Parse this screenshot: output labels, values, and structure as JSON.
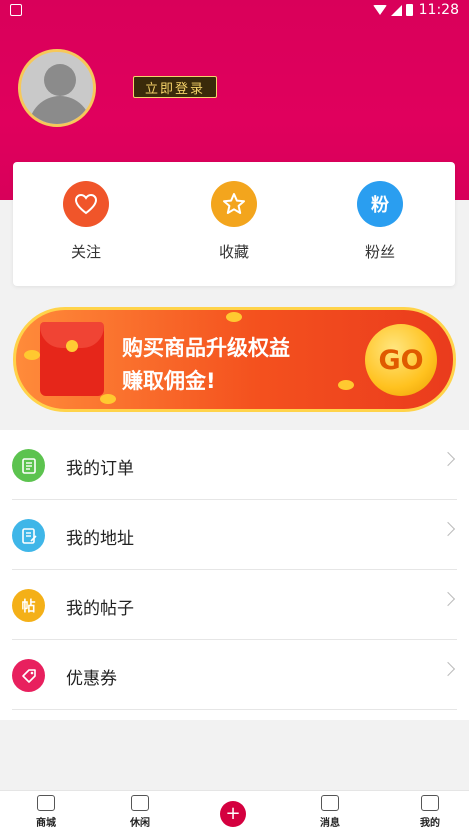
{
  "status_bar": {
    "time": "11:28",
    "icons": [
      "notification-icon",
      "wifi-icon",
      "signal-icon",
      "battery-icon"
    ]
  },
  "profile": {
    "login_label": "立即登录"
  },
  "stats": [
    {
      "label": "关注",
      "icon": "heart-icon",
      "color": "#f0552a"
    },
    {
      "label": "收藏",
      "icon": "star-icon",
      "color": "#f3a51d"
    },
    {
      "label": "粉丝",
      "icon": "fans-icon",
      "icon_text": "粉",
      "color": "#2a9ef0"
    }
  ],
  "banner": {
    "line1": "购买商品升级权益",
    "line2": "赚取佣金!",
    "go_label": "GO"
  },
  "menu": [
    {
      "label": "我的订单",
      "icon": "order-icon",
      "color": "#5cc34f"
    },
    {
      "label": "我的地址",
      "icon": "address-icon",
      "color": "#3fb6e8"
    },
    {
      "label": "我的帖子",
      "icon": "post-icon",
      "icon_text": "帖",
      "color": "#f4b018"
    },
    {
      "label": "优惠券",
      "icon": "coupon-icon",
      "color": "#e8205e"
    }
  ],
  "tabbar": {
    "tabs": [
      {
        "label": "商城",
        "icon": "shop-icon"
      },
      {
        "label": "休闲",
        "icon": "video-icon"
      },
      {
        "label": "",
        "icon": "plus-icon"
      },
      {
        "label": "消息",
        "icon": "message-icon"
      },
      {
        "label": "我的",
        "icon": "user-icon"
      }
    ]
  },
  "colors": {
    "brand": "#d9005a",
    "accent_gold": "#f5d36a",
    "banner_orange": "#f4511e"
  }
}
